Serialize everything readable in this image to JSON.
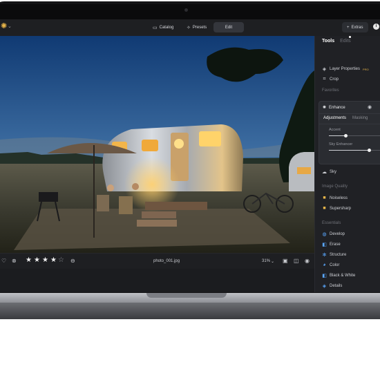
{
  "topbar": {
    "nav": [
      {
        "label": "Catalog",
        "icon": "folder-icon",
        "active": false
      },
      {
        "label": "Presets",
        "icon": "presets-icon",
        "active": false
      },
      {
        "label": "Edit",
        "icon": "",
        "active": true
      }
    ],
    "extras_label": "Extras",
    "extras_icon": "plus-icon",
    "info_icon": "info-icon"
  },
  "panel": {
    "tabs": [
      {
        "label": "Tools",
        "active": true
      },
      {
        "label": "Edits",
        "active": false
      }
    ],
    "layer_properties": "Layer Properties",
    "layer_badge": "PRO",
    "crop": "Crop",
    "favorites_title": "Favorites",
    "enhance": {
      "title": "Enhance",
      "subtabs": [
        "Adjustments",
        "Masking"
      ],
      "sliders": [
        {
          "label": "Accent",
          "value": 0.3
        },
        {
          "label": "Sky Enhancer",
          "value": 0.72
        }
      ]
    },
    "sky": "Sky",
    "image_quality_title": "Image Quality",
    "noiseless": "Noiseless",
    "supersharp": "Supersharp",
    "essentials_title": "Essentials",
    "essentials_items": [
      "Develop",
      "Erase",
      "Structure",
      "Color",
      "Black & White",
      "Details"
    ]
  },
  "bottombar": {
    "filename": "photo_001.jpg",
    "zoom": "31%",
    "rating": 4,
    "rating_max": 5
  },
  "colors": {
    "accent": "#e9b64a",
    "panel_bg": "#202125",
    "topbar_bg": "#1e1f22",
    "sky_top": "#123f7a",
    "sky_horizon": "#6f8fb1"
  }
}
